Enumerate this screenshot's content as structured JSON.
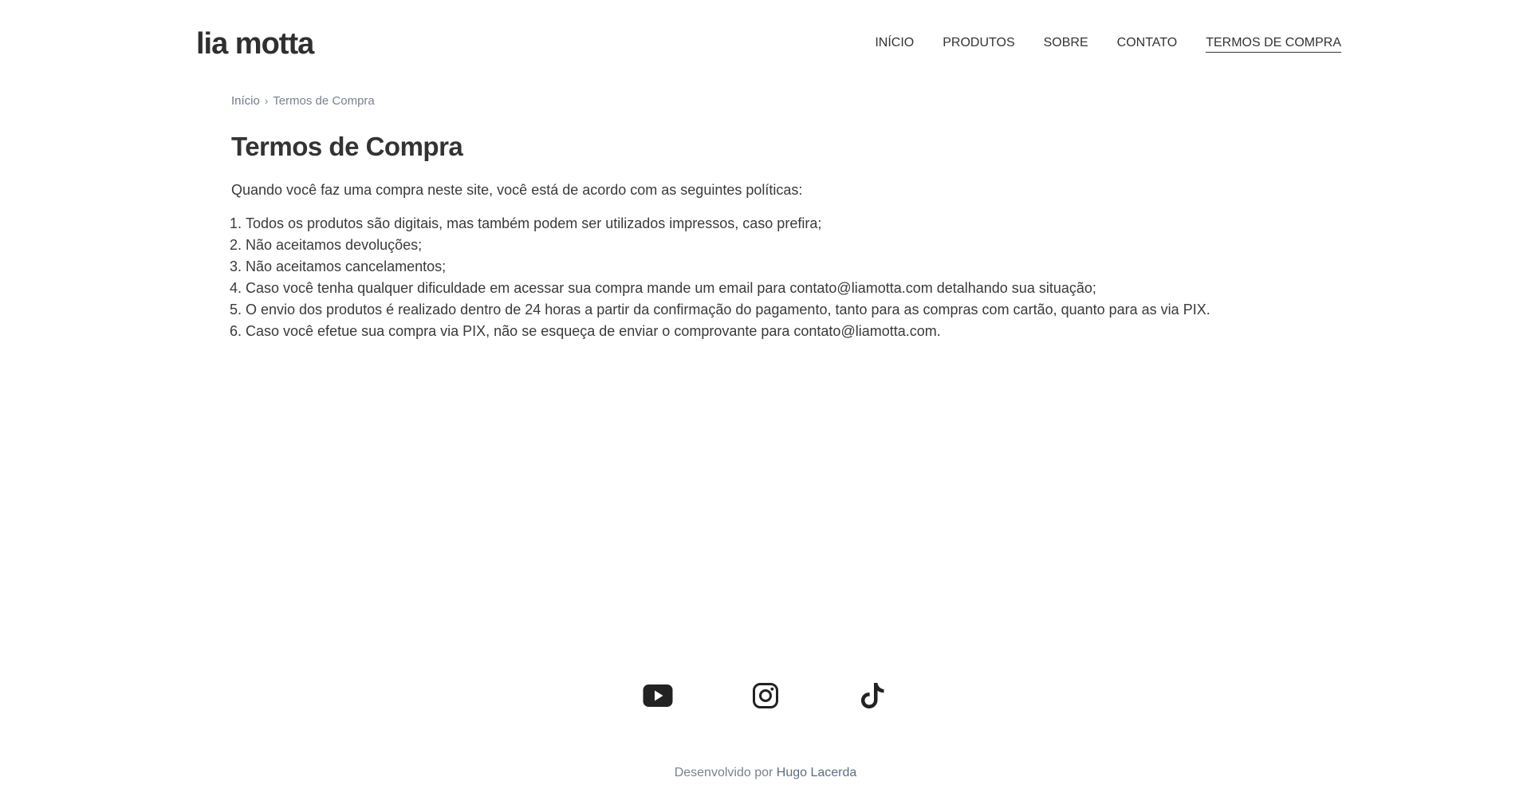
{
  "header": {
    "logo": "lia motta",
    "nav": [
      {
        "label": "INÍCIO",
        "active": false
      },
      {
        "label": "PRODUTOS",
        "active": false
      },
      {
        "label": "SOBRE",
        "active": false
      },
      {
        "label": "CONTATO",
        "active": false
      },
      {
        "label": "TERMOS DE COMPRA",
        "active": true
      }
    ]
  },
  "breadcrumb": {
    "home": "Início",
    "separator": "›",
    "current": "Termos de Compra"
  },
  "main": {
    "title": "Termos de Compra",
    "intro": "Quando você faz uma compra neste site, você está de acordo com as seguintes políticas:",
    "terms": [
      "Todos os produtos são digitais, mas também podem ser utilizados impressos, caso prefira;",
      "Não aceitamos devoluções;",
      "Não aceitamos cancelamentos;",
      "Caso você tenha qualquer dificuldade em acessar sua compra mande um email para contato@liamotta.com detalhando sua situação;",
      "O envio dos produtos é realizado dentro de 24 horas a partir da confirmação do pagamento, tanto para as compras com cartão, quanto para as via PIX.",
      "Caso você efetue sua compra via PIX, não se esqueça de enviar o comprovante para contato@liamotta.com."
    ]
  },
  "footer": {
    "social_icons": [
      "youtube-icon",
      "instagram-icon",
      "tiktok-icon"
    ],
    "credit_prefix": "Desenvolvido por",
    "credit_name": "Hugo Lacerda"
  },
  "colors": {
    "text": "#333333",
    "muted": "#7a8290",
    "link_muted": "#5f6e82"
  }
}
